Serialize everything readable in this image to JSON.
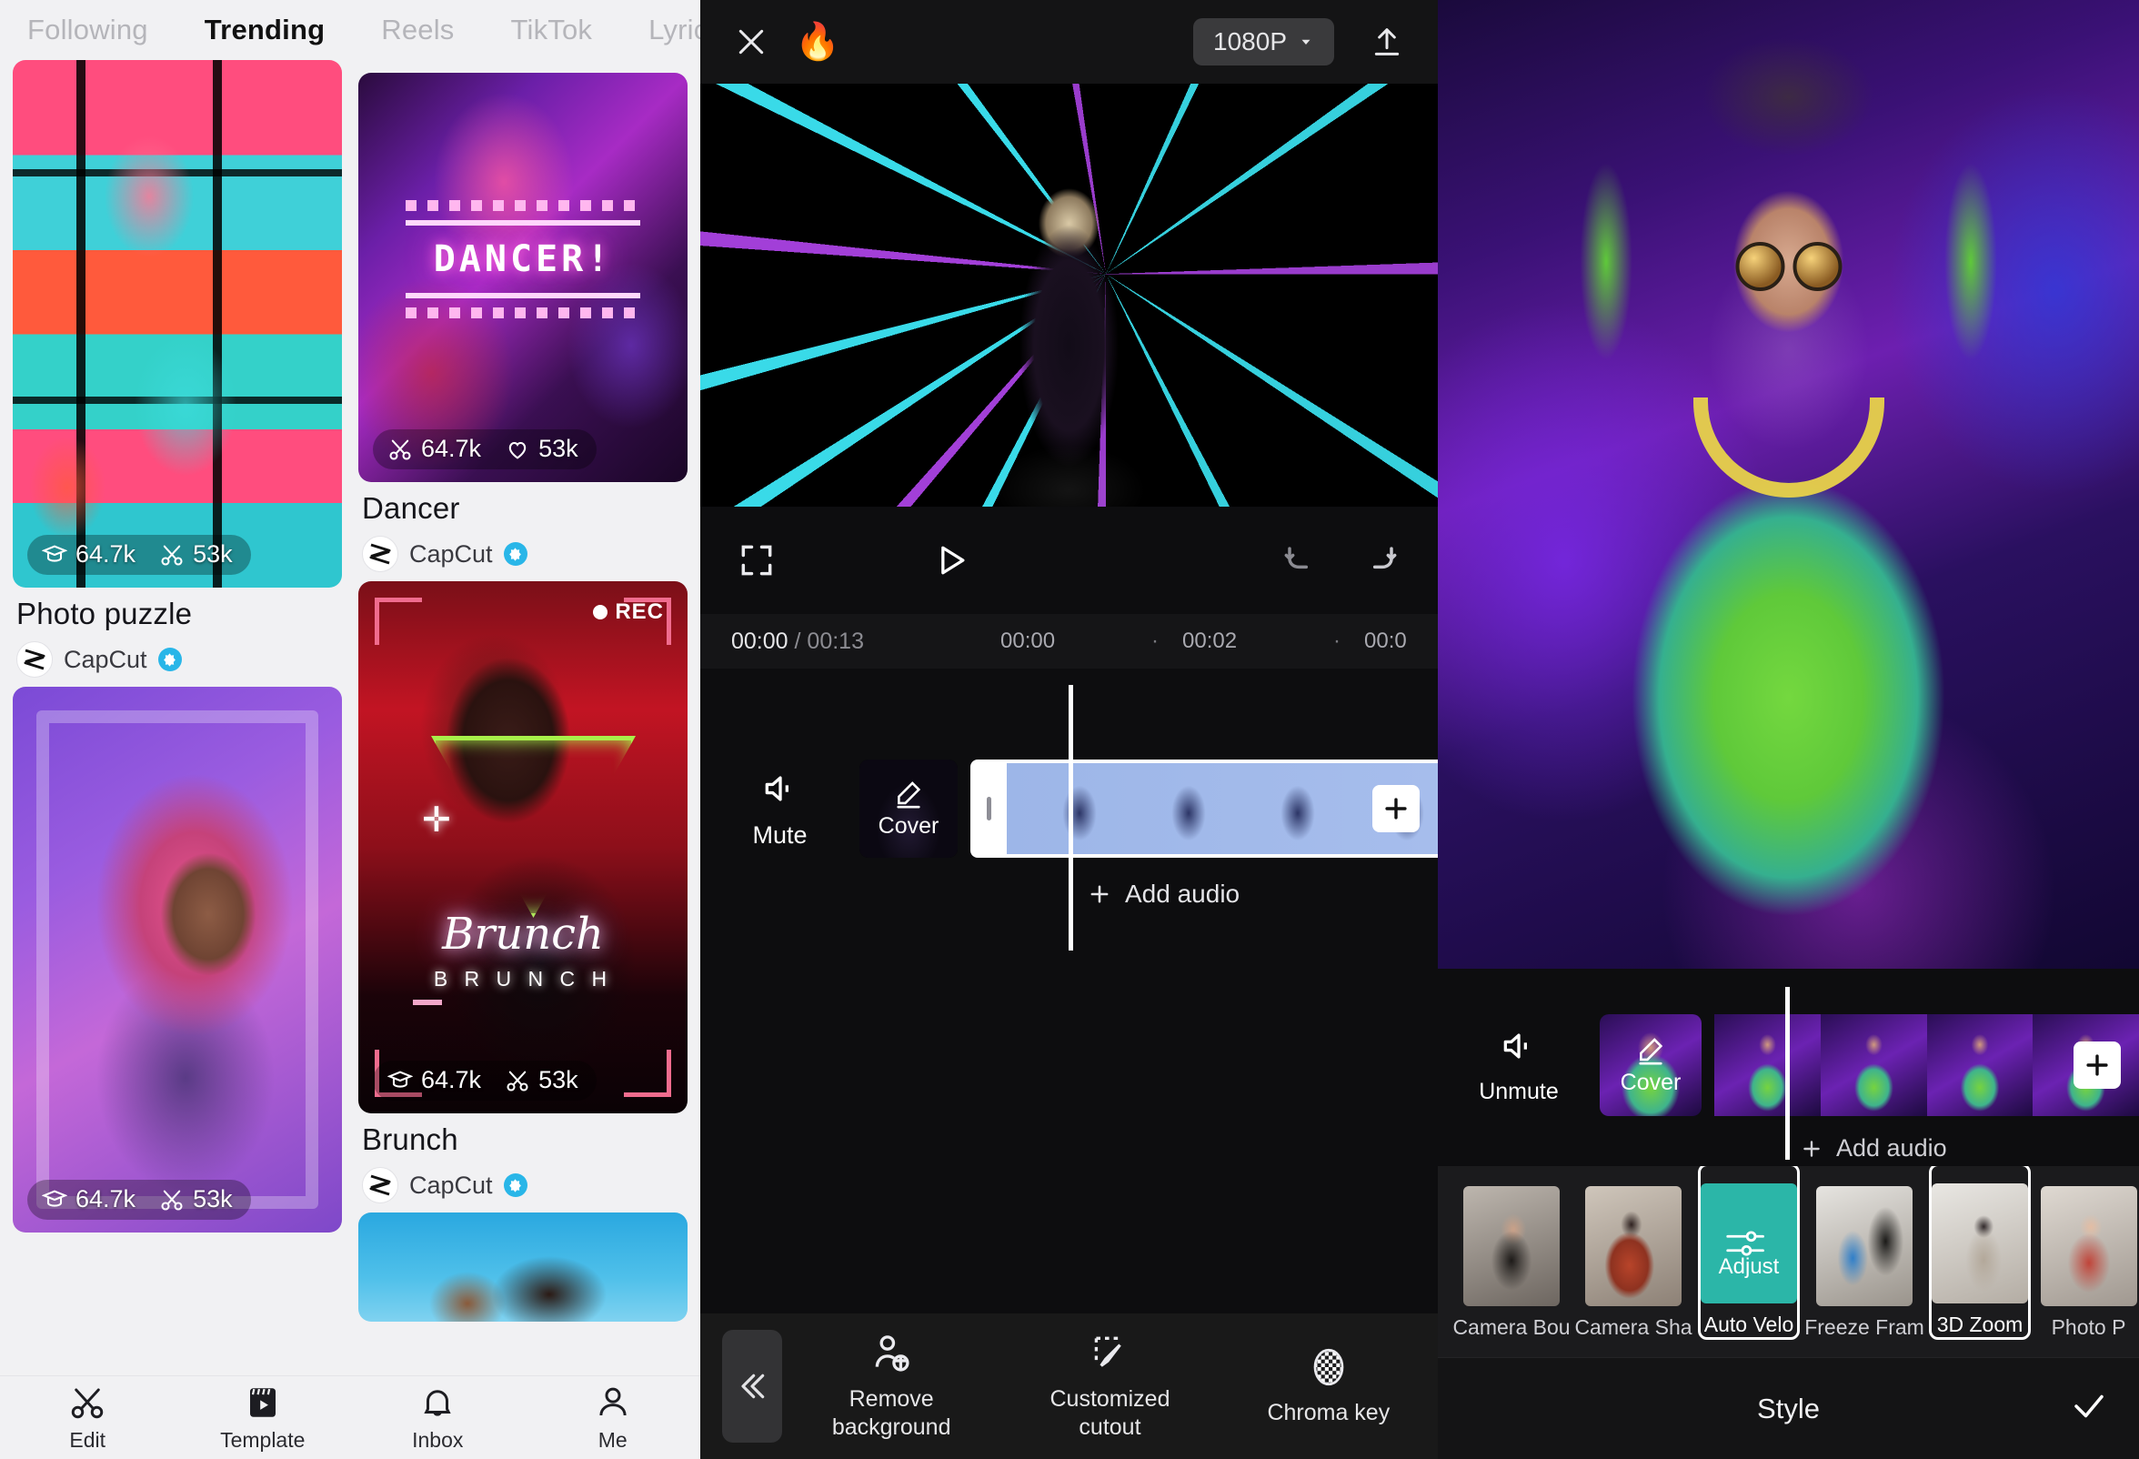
{
  "feed": {
    "tabs": [
      {
        "label": "Following",
        "active": false
      },
      {
        "label": "Trending",
        "active": true
      },
      {
        "label": "Reels",
        "active": false
      },
      {
        "label": "TikTok",
        "active": false
      },
      {
        "label": "Lyric",
        "active": false
      }
    ],
    "cards": [
      {
        "title": "Photo puzzle",
        "author": "CapCut",
        "verified": true,
        "stat1_icon": "template-uses-icon",
        "stat1": "64.7k",
        "stat2_icon": "scissors-icon",
        "stat2": "53k"
      },
      {
        "title": "Dancer",
        "author": "CapCut",
        "verified": true,
        "overlay_text": "DANCER!",
        "stat1_icon": "scissors-icon",
        "stat1": "64.7k",
        "stat2_icon": "heart-icon",
        "stat2": "53k"
      },
      {
        "title": "Brunch",
        "author": "CapCut",
        "verified": true,
        "overlay_text": "Brunch",
        "overlay_subtext": "B R U N C H",
        "rec_label": "REC",
        "stat1_icon": "template-uses-icon",
        "stat1": "64.7k",
        "stat2_icon": "scissors-icon",
        "stat2": "53k"
      }
    ],
    "nav": [
      {
        "label": "Edit",
        "icon": "scissors-icon",
        "active": false
      },
      {
        "label": "Template",
        "icon": "clapperboard-icon",
        "active": true
      },
      {
        "label": "Inbox",
        "icon": "bell-icon",
        "active": false
      },
      {
        "label": "Me",
        "icon": "person-icon",
        "active": false
      }
    ]
  },
  "editor": {
    "top": {
      "close_icon": "close-icon",
      "flame_icon": "flame-icon",
      "resolution": "1080P",
      "resolution_caret": "chevron-down-icon",
      "export_icon": "upload-icon"
    },
    "playback": {
      "fullscreen_icon": "fullscreen-icon",
      "play_icon": "play-icon",
      "undo_icon": "undo-icon",
      "redo_icon": "redo-icon"
    },
    "ruler": {
      "current_time": "00:00",
      "separator": "/",
      "total_time": "00:13",
      "ticks": [
        "00:00",
        "00:02",
        "00:0"
      ]
    },
    "timeline": {
      "mute_label": "Mute",
      "mute_icon": "volume-icon",
      "cover_label": "Cover",
      "cover_icon": "pencil-icon",
      "add_clip_icon": "plus-icon",
      "add_audio_label": "Add audio",
      "add_audio_icon": "plus-icon"
    },
    "tools": {
      "collapse_icon": "chevron-double-left-icon",
      "items": [
        {
          "label": "Remove\nbackground",
          "line1": "Remove",
          "line2": "background",
          "icon": "remove-background-icon"
        },
        {
          "label": "Customized cutout",
          "line1": "Customized",
          "line2": "cutout",
          "icon": "cutout-pen-icon"
        },
        {
          "label": "Chroma key",
          "line1": "Chroma key",
          "line2": "",
          "icon": "chroma-key-icon"
        }
      ]
    }
  },
  "style_panel": {
    "timeline": {
      "mute_label": "Unmute",
      "mute_icon": "volume-icon",
      "cover_label": "Cover",
      "cover_icon": "pencil-icon",
      "add_clip_icon": "plus-icon",
      "add_audio_label": "Add audio",
      "add_audio_icon": "plus-icon"
    },
    "effects": [
      {
        "label": "Camera Bou",
        "selected": false,
        "kind": "photo-a"
      },
      {
        "label": "Camera Sha",
        "selected": false,
        "kind": "photo-b"
      },
      {
        "label": "Auto Velo",
        "selected": true,
        "kind": "adjust",
        "tile_label": "Adjust",
        "tile_icon": "sliders-icon"
      },
      {
        "label": "Freeze Fram",
        "selected": false,
        "kind": "photo-c"
      },
      {
        "label": "3D Zoom",
        "selected": true,
        "kind": "photo-d"
      },
      {
        "label": "Photo P",
        "selected": false,
        "kind": "photo-e"
      }
    ],
    "bottom": {
      "title": "Style",
      "confirm_icon": "check-icon"
    }
  },
  "colors": {
    "accent_blue": "#29b6e8",
    "teal_tile": "#2bb6a8",
    "dark_bg": "#0d0d0f",
    "light_bg": "#f1f1f3"
  }
}
